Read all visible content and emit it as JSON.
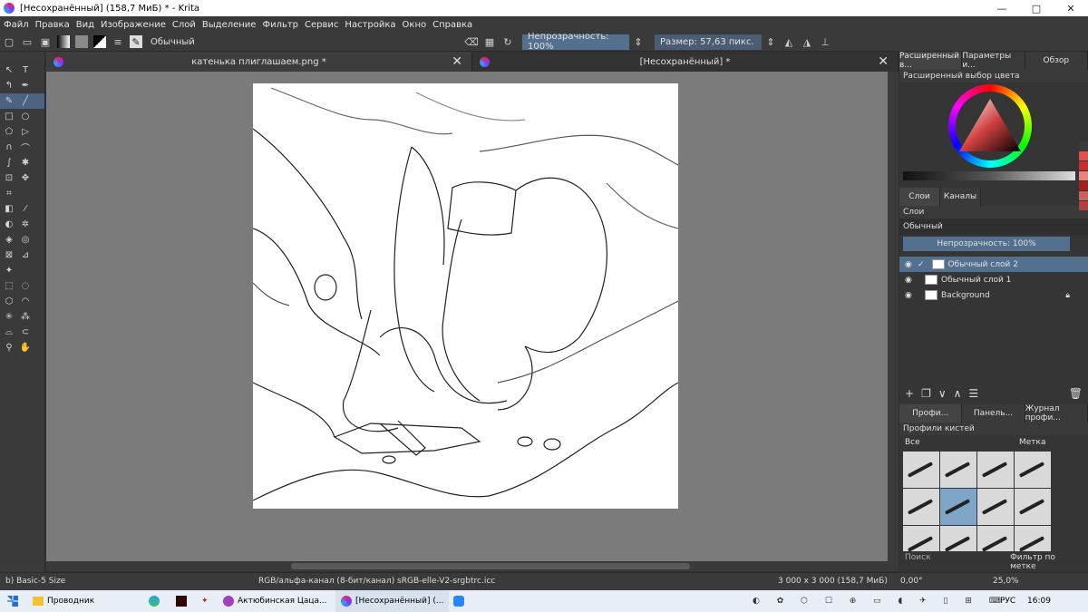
{
  "window": {
    "title": "[Несохранённый]  (158,7 МиБ)  * - Krita",
    "min": "—",
    "max": "□",
    "close": "✕"
  },
  "menu": [
    "Файл",
    "Правка",
    "Вид",
    "Изображение",
    "Слой",
    "Выделение",
    "Фильтр",
    "Сервис",
    "Настройка",
    "Окно",
    "Справка"
  ],
  "toolbar": {
    "blend_mode": "Обычный",
    "opacity": "Непрозрачность: 100%",
    "size": "Размер: 57,63 пикс."
  },
  "tabs": [
    {
      "label": "катенька плиглашаем.png *",
      "close": "✕"
    },
    {
      "label": "[Несохранённый]  *",
      "close": "✕"
    }
  ],
  "right_panel": {
    "top_tabs": [
      "Расширенный в...",
      "Параметры и...",
      "Обзор"
    ],
    "color_title": "Расширенный выбор цвета",
    "layer_tabs": [
      "Слои",
      "Каналы"
    ],
    "layers_title": "Слои",
    "layer_blend": "Обычный",
    "layer_opacity": "Непрозрачность:  100%",
    "layers": [
      {
        "name": "Обычный слой 2"
      },
      {
        "name": "Обычный слой 1"
      },
      {
        "name": "Background"
      }
    ],
    "bottom_tabs": [
      "Профи...",
      "Панель...",
      "Журнал профи..."
    ],
    "brush_title": "Профили кистей",
    "brush_filter": "Все",
    "brush_tag": "Метка",
    "search_placeholder": "Поиск",
    "filter_by_tag": "Фильтр по метке"
  },
  "status": {
    "brush": "b) Basic-5 Size",
    "colorspace": "RGB/альфа-канал (8-бит/канал)  sRGB-elle-V2-srgbtrc.icc",
    "dimensions": "3 000 x 3 000 (158,7 МиБ)",
    "rotation": "0,00°",
    "zoom": "25,0%"
  },
  "taskbar": {
    "explorer": "Проводник",
    "browser_tab": "Актюбинская Цаца...",
    "krita_tab": "[Несохранённый] (...",
    "lang": "РУС",
    "time": "16:09"
  },
  "colors": {
    "accent": "#54708f",
    "selected_brush": "#7fa6c9"
  }
}
